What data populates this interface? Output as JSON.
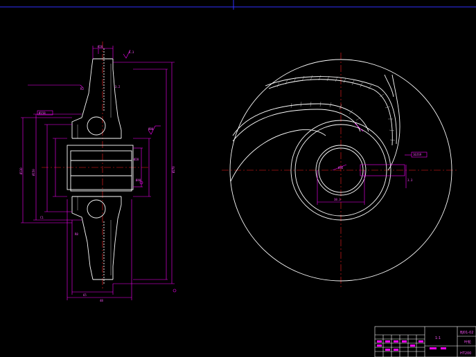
{
  "colors": {
    "background": "#000000",
    "outline": "#ffffff",
    "dimension": "#ff00ff",
    "centerline": "#ff2020",
    "frame": "#3030ff",
    "titleblock": "#ffffff"
  },
  "section_view": {
    "dim_labels": {
      "top_width": "Ø20",
      "roughness_top": "6.3",
      "leader_note": "R3",
      "roughness_mid": "3.2",
      "side_note_left": "Ø158",
      "hub_note": "Ø80",
      "keyway": "Ø28",
      "bore_label": "Ø40",
      "outer_dia": "Ø270",
      "hub_dia_left": "Ø130",
      "left_dim2": "Ø150",
      "bottom_len": "65",
      "bottom_len2": "48",
      "small_r": "R8",
      "chamfer": "C1"
    }
  },
  "impeller_view": {
    "bore_label": "Ø36",
    "key_label": "38.3",
    "width_label": "10JS9",
    "height_label": "3.3"
  },
  "title_block": {
    "drawing_no": "BJ01-02",
    "name": "叶轮",
    "scale": "1:1",
    "material": "HT200"
  }
}
